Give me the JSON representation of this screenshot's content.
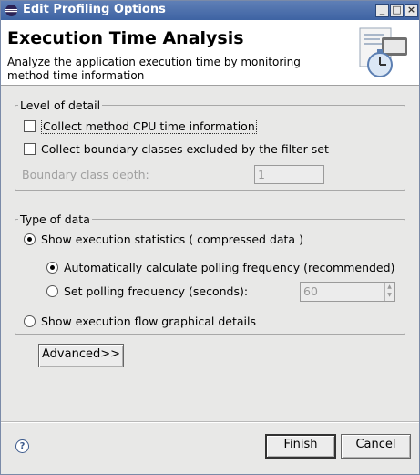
{
  "window": {
    "title": "Edit Profiling Options",
    "controls": {
      "minimize": "_",
      "maximize": "□",
      "close": "×"
    }
  },
  "header": {
    "title": "Execution Time Analysis",
    "description": "Analyze the application execution time by monitoring method time information"
  },
  "level_of_detail": {
    "label": "Level of detail",
    "collect_cpu": {
      "label": "Collect method CPU time information",
      "checked": false
    },
    "collect_boundary": {
      "label": "Collect boundary classes excluded by the filter set",
      "checked": false
    },
    "boundary_depth": {
      "label": "Boundary class depth:",
      "value": "1",
      "enabled": false
    }
  },
  "type_of_data": {
    "label": "Type of data",
    "show_stats": {
      "label": "Show execution statistics ( compressed data )",
      "selected": true
    },
    "auto_polling": {
      "label": "Automatically calculate polling frequency (recommended)",
      "selected": true
    },
    "set_polling": {
      "label": "Set polling frequency (seconds):",
      "selected": false,
      "value": "60"
    },
    "show_flow": {
      "label": "Show execution flow graphical details",
      "selected": false
    }
  },
  "buttons": {
    "advanced": "Advanced>>",
    "finish": "Finish",
    "cancel": "Cancel",
    "help": "?"
  },
  "icons": {
    "title": "eclipse-icon",
    "header": "profiling-stopwatch-icon"
  },
  "colors": {
    "titlebar": "#4a6ea9",
    "dialog_bg": "#e8e8e7"
  }
}
